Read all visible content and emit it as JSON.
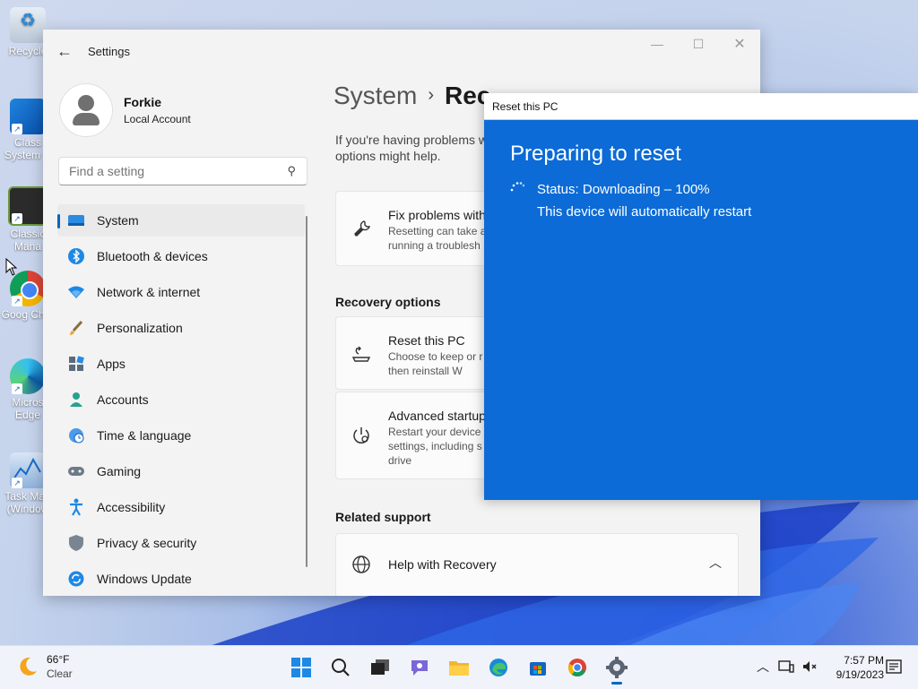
{
  "desktop": {
    "icons": [
      {
        "label": "Recycle"
      },
      {
        "label": "Class System C"
      },
      {
        "label": "Classic Mana"
      },
      {
        "label": "Goog Chro"
      },
      {
        "label": "Micros Edge"
      },
      {
        "label": "Task Man (Window"
      }
    ]
  },
  "settings": {
    "app_title": "Settings",
    "profile": {
      "name": "Forkie",
      "type": "Local Account"
    },
    "search": {
      "placeholder": "Find a setting"
    },
    "nav": [
      {
        "label": "System",
        "icon": "system-icon",
        "active": true
      },
      {
        "label": "Bluetooth & devices",
        "icon": "bluetooth-icon"
      },
      {
        "label": "Network & internet",
        "icon": "network-icon"
      },
      {
        "label": "Personalization",
        "icon": "brush-icon"
      },
      {
        "label": "Apps",
        "icon": "apps-icon"
      },
      {
        "label": "Accounts",
        "icon": "accounts-icon"
      },
      {
        "label": "Time & language",
        "icon": "globe-clock-icon"
      },
      {
        "label": "Gaming",
        "icon": "gamepad-icon"
      },
      {
        "label": "Accessibility",
        "icon": "accessibility-icon"
      },
      {
        "label": "Privacy & security",
        "icon": "shield-icon"
      },
      {
        "label": "Windows Update",
        "icon": "update-icon"
      }
    ],
    "breadcrumb": {
      "parent": "System",
      "current": "Rec"
    },
    "description": "If you're having problems w options might help.",
    "fix_card": {
      "title": "Fix problems with",
      "sub": "Resetting can take a running a troublesh"
    },
    "recovery_heading": "Recovery options",
    "reset_card": {
      "title": "Reset this PC",
      "sub": "Choose to keep or r files, then reinstall W"
    },
    "advanced_card": {
      "title": "Advanced startup",
      "sub": "Restart your device settings, including s USB drive"
    },
    "support_heading": "Related support",
    "help_card": {
      "title": "Help with Recovery"
    }
  },
  "reset_dialog": {
    "title": "Reset this PC",
    "heading": "Preparing to reset",
    "status": "Status: Downloading – 100%",
    "note": "This device will automatically restart"
  },
  "taskbar": {
    "weather": {
      "temp": "66°F",
      "condition": "Clear"
    },
    "time": "7:57 PM",
    "date": "9/19/2023"
  },
  "colors": {
    "accent": "#0067c0",
    "reset_bg": "#0c6bd6"
  }
}
